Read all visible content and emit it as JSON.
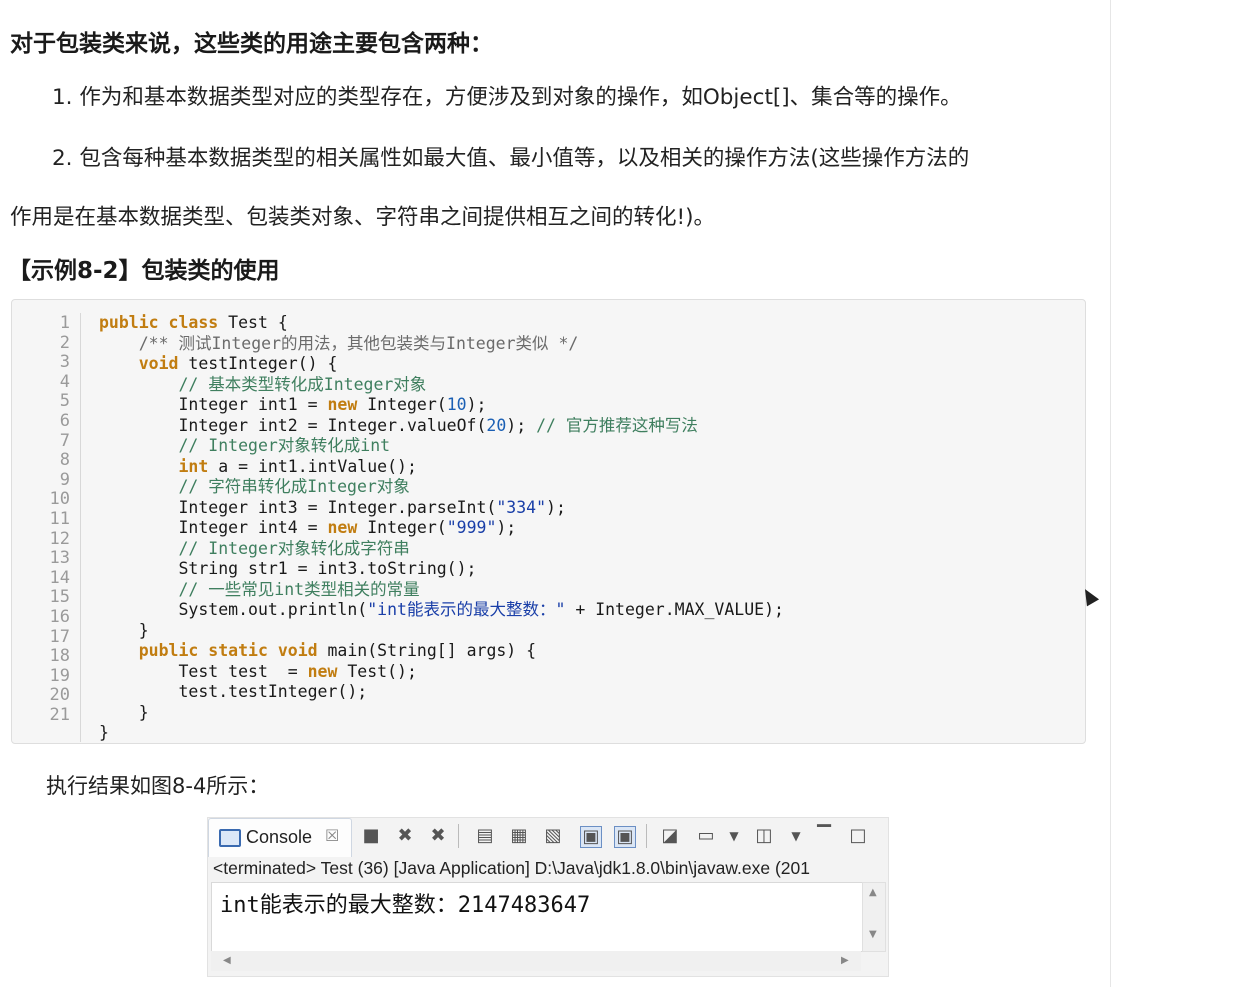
{
  "heading1": "对于包装类来说，这些类的用途主要包含两种：",
  "paragraphs": [
    "1. 作为和基本数据类型对应的类型存在，方便涉及到对象的操作，如Object[]、集合等的操作。",
    "2. 包含每种基本数据类型的相关属性如最大值、最小值等，以及相关的操作方法(这些操作方法的",
    "作用是在基本数据类型、包装类对象、字符串之间提供相互之间的转化!)。"
  ],
  "heading2": "【示例8-2】包装类的使用",
  "code": {
    "line_numbers": [
      "1",
      "2",
      "3",
      "4",
      "5",
      "6",
      "7",
      "8",
      "9",
      "10",
      "11",
      "12",
      "13",
      "14",
      "15",
      "16",
      "17",
      "18",
      "19",
      "20",
      "21"
    ],
    "lines": [
      [
        {
          "t": "public class",
          "c": "kw"
        },
        {
          "t": " Test {",
          "c": ""
        }
      ],
      [
        {
          "t": "    /** 测试Integer的用法，其他包装类与Integer类似 */",
          "c": "cm-gray"
        }
      ],
      [
        {
          "t": "    ",
          "c": ""
        },
        {
          "t": "void",
          "c": "kw"
        },
        {
          "t": " testInteger() {",
          "c": ""
        }
      ],
      [
        {
          "t": "        // 基本类型转化成Integer对象",
          "c": "cm"
        }
      ],
      [
        {
          "t": "        Integer int1 = ",
          "c": ""
        },
        {
          "t": "new",
          "c": "kw"
        },
        {
          "t": " Integer(",
          "c": ""
        },
        {
          "t": "10",
          "c": "num"
        },
        {
          "t": ");",
          "c": ""
        }
      ],
      [
        {
          "t": "        Integer int2 = Integer.valueOf(",
          "c": ""
        },
        {
          "t": "20",
          "c": "num"
        },
        {
          "t": "); ",
          "c": ""
        },
        {
          "t": "// 官方推荐这种写法",
          "c": "cm"
        }
      ],
      [
        {
          "t": "        // Integer对象转化成int",
          "c": "cm"
        }
      ],
      [
        {
          "t": "        ",
          "c": ""
        },
        {
          "t": "int",
          "c": "kw"
        },
        {
          "t": " a = int1.intValue();",
          "c": ""
        }
      ],
      [
        {
          "t": "        // 字符串转化成Integer对象",
          "c": "cm"
        }
      ],
      [
        {
          "t": "        Integer int3 = Integer.parseInt(",
          "c": ""
        },
        {
          "t": "\"334\"",
          "c": "str"
        },
        {
          "t": ");",
          "c": ""
        }
      ],
      [
        {
          "t": "        Integer int4 = ",
          "c": ""
        },
        {
          "t": "new",
          "c": "kw"
        },
        {
          "t": " Integer(",
          "c": ""
        },
        {
          "t": "\"999\"",
          "c": "str"
        },
        {
          "t": ");",
          "c": ""
        }
      ],
      [
        {
          "t": "        // Integer对象转化成字符串",
          "c": "cm"
        }
      ],
      [
        {
          "t": "        String str1 = int3.toString();",
          "c": ""
        }
      ],
      [
        {
          "t": "        // 一些常见int类型相关的常量",
          "c": "cm"
        }
      ],
      [
        {
          "t": "        System.out.println(",
          "c": ""
        },
        {
          "t": "\"int能表示的最大整数：\"",
          "c": "str"
        },
        {
          "t": " + Integer.MAX_VALUE);",
          "c": ""
        }
      ],
      [
        {
          "t": "    }",
          "c": ""
        }
      ],
      [
        {
          "t": "    ",
          "c": ""
        },
        {
          "t": "public static void",
          "c": "kw"
        },
        {
          "t": " main(String[] args) {",
          "c": ""
        }
      ],
      [
        {
          "t": "        Test test  = ",
          "c": ""
        },
        {
          "t": "new",
          "c": "kw"
        },
        {
          "t": " Test();",
          "c": ""
        }
      ],
      [
        {
          "t": "        test.testInteger();",
          "c": ""
        }
      ],
      [
        {
          "t": "    }",
          "c": ""
        }
      ],
      [
        {
          "t": "}",
          "c": ""
        }
      ]
    ]
  },
  "caption": "执行结果如图8-4所示：",
  "console": {
    "tab_label": "Console",
    "tab_close": "☒",
    "status": "<terminated> Test (36) [Java Application] D:\\Java\\jdk1.8.0\\bin\\javaw.exe (201",
    "output": "int能表示的最大整数：2147483647",
    "toolbar_icons": [
      "stop-icon",
      "remove-launch-icon",
      "remove-all-icon",
      "clear-console-icon",
      "scroll-lock-icon",
      "word-wrap-icon",
      "show-on-stdout-icon",
      "show-on-stderr-icon",
      "pin-console-icon",
      "display-console-icon",
      "dropdown-icon",
      "open-console-icon",
      "dropdown-icon",
      "minimize-icon",
      "maximize-icon"
    ]
  },
  "colors": {
    "keyword": "#c17d11",
    "comment": "#3f7f5f",
    "number": "#1a5fb4",
    "string": "#1a3fa8"
  }
}
